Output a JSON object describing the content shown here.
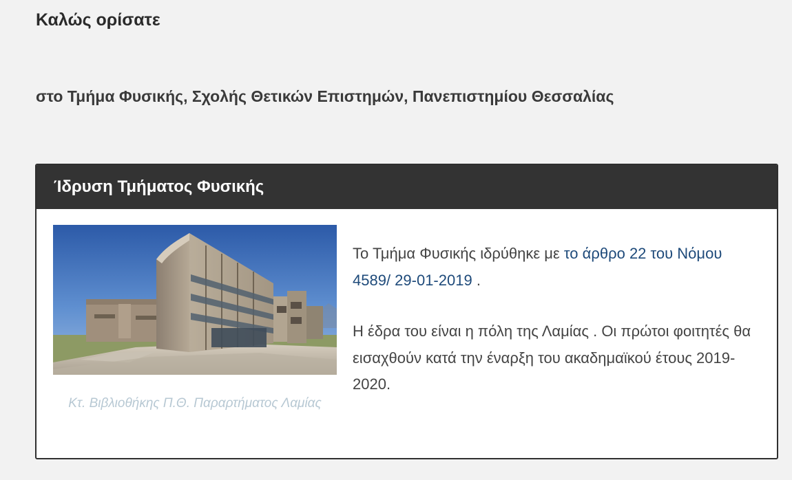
{
  "welcome": {
    "title": "Καλώς ορίσατε",
    "subtitle": "στο Τμήμα Φυσικής, Σχολής Θετικών Επιστημών, Πανεπιστημίου Θεσσαλίας"
  },
  "panel": {
    "title": "Ίδρυση Τμήματος Φυσικής",
    "image": {
      "icon": "library-building-photo",
      "caption": "Κτ. Βιβλιοθήκης Π.Θ. Παραρτήματος Λαμίας"
    },
    "paragraph1": {
      "prefix": "Το Τμήμα Φυσικής ιδρύθηκε με ",
      "link": "το άρθρο 22 του Νόμου 4589/ 29-01-2019",
      "suffix": " ."
    },
    "paragraph2": {
      "text": "Η έδρα του είναι η πόλη της Λαμίας . Οι πρώτοι φοιτητές θα εισαχθούν κατά την έναρξη του ακαδημαϊκού έτους 2019-2020."
    }
  },
  "colors": {
    "page_background": "#f2f2f2",
    "panel_header": "#333333",
    "link": "#1e4a7a",
    "caption": "#b7c8d3"
  }
}
